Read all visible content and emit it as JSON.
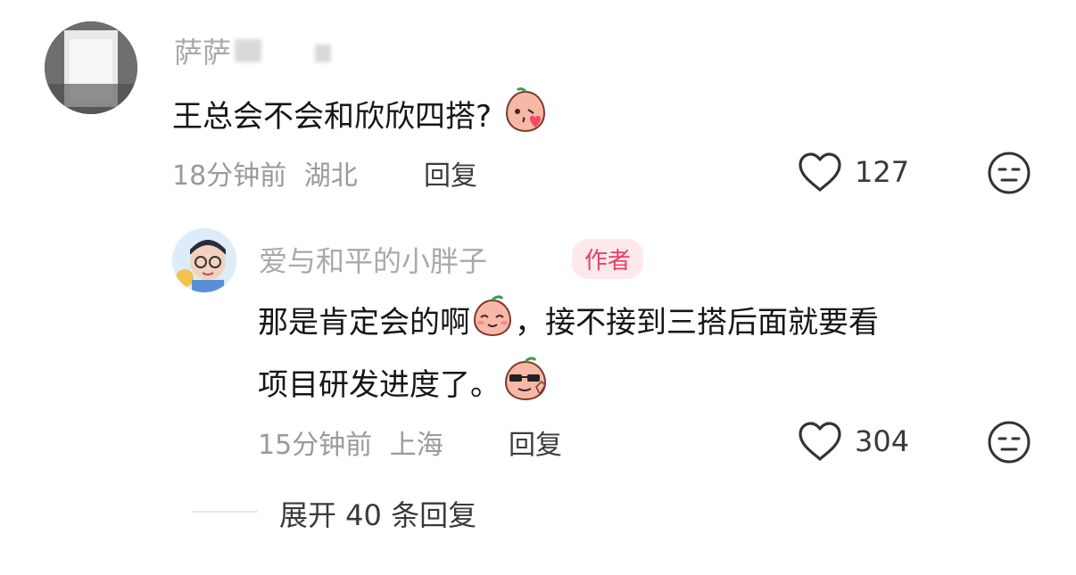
{
  "comments": [
    {
      "username": "萨萨",
      "text": "王总会不会和欣欣四搭?",
      "emoji": "kiss-heart-emoji",
      "time": "18分钟前",
      "location": "湖北",
      "reply_label": "回复",
      "likes": "127"
    }
  ],
  "reply": {
    "username": "爱与和平的小胖子",
    "badge": "作者",
    "text_line1_a": "那是肯定会的啊",
    "text_line1_b": "，接不接到三搭后面就要看",
    "text_line2": "项目研发进度了。",
    "time": "15分钟前",
    "location": "上海",
    "reply_label": "回复",
    "likes": "304"
  },
  "expand_label": "展开 40 条回复",
  "colors": {
    "badge_bg": "#fde9ec",
    "badge_text": "#e8405f",
    "emoji_body": "#f7b8a6"
  }
}
